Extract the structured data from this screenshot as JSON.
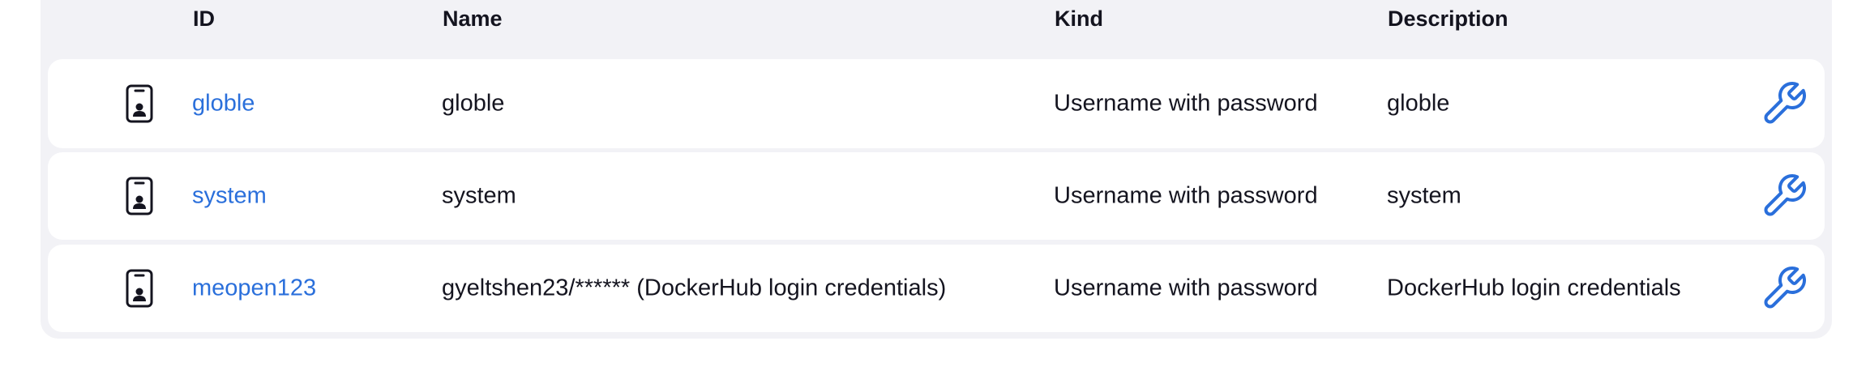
{
  "table": {
    "headers": {
      "id": "ID",
      "name": "Name",
      "kind": "Kind",
      "description": "Description"
    },
    "rows": [
      {
        "icon": "credential-id-card-icon",
        "id": "globle",
        "name": "globle",
        "kind": "Username with password",
        "description": "globle",
        "action_icon": "wrench-icon"
      },
      {
        "icon": "credential-id-card-icon",
        "id": "system",
        "name": "system",
        "kind": "Username with password",
        "description": "system",
        "action_icon": "wrench-icon"
      },
      {
        "icon": "credential-id-card-icon",
        "id": "meopen123",
        "name": "gyeltshen23/****** (DockerHub login credentials)",
        "kind": "Username with password",
        "description": "DockerHub login credentials",
        "action_icon": "wrench-icon"
      }
    ]
  },
  "colors": {
    "link": "#2a6fdb",
    "table_bg": "#f2f2f6",
    "row_bg": "#ffffff",
    "text": "#14141f"
  }
}
